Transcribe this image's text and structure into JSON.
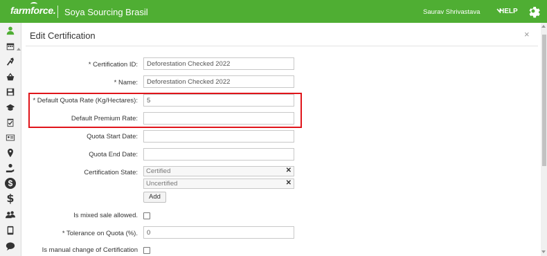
{
  "header": {
    "brand": "farmforce.",
    "app_name": "Soya Sourcing Brasil",
    "user_name": "Saurav Shrivastava",
    "help_label": "HELP"
  },
  "sidebar": {
    "icons": [
      "user-icon",
      "calendar-icon",
      "plant-icon",
      "basket-icon",
      "save-icon",
      "graduation-cap-icon",
      "clipboard-check-icon",
      "id-card-icon",
      "location-pin-icon",
      "hand-coin-icon",
      "dollar-circle-icon",
      "dollar-icon",
      "group-icon",
      "tablet-icon",
      "chat-icon"
    ]
  },
  "modal": {
    "title": "Edit Certification",
    "close_glyph": "×",
    "fields": {
      "certification_id": {
        "label": "Certification ID:",
        "required": true,
        "value": "Deforestation Checked 2022"
      },
      "name": {
        "label": "Name:",
        "required": true,
        "value": "Deforestation Checked 2022"
      },
      "default_quota_rate": {
        "label": "Default Quota Rate (Kg/Hectares):",
        "required": true,
        "value": "5"
      },
      "default_premium_rate": {
        "label": "Default Premium Rate:",
        "required": false,
        "value": ""
      },
      "quota_start_date": {
        "label": "Quota Start Date:",
        "required": false,
        "value": ""
      },
      "quota_end_date": {
        "label": "Quota End Date:",
        "required": false,
        "value": ""
      },
      "certification_state": {
        "label": "Certification State:",
        "required": false,
        "values": [
          "Certified",
          "Uncertified"
        ],
        "add_label": "Add"
      },
      "mixed_sale_allowed": {
        "label": "Is mixed sale allowed.",
        "required": false,
        "checked": false
      },
      "tolerance_on_quota": {
        "label": "Tolerance on Quota (%).",
        "required": true,
        "value": "0"
      },
      "manual_change": {
        "label": "Is manual change of Certification",
        "required": false,
        "checked": false
      }
    },
    "required_marker": "*"
  },
  "colors": {
    "header_bg": "#4fae33",
    "highlight_border": "#e0141a"
  }
}
